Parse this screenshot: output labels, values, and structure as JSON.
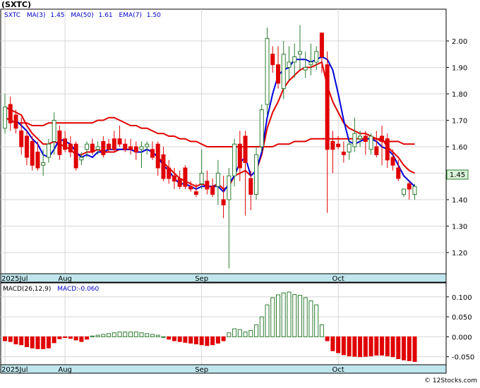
{
  "title": "(SXTC)",
  "watermark": "© 12Stocks.com",
  "price_legend": {
    "symbol": "SXTC",
    "ma3_label": "MA(3)",
    "ma3_value": "1.45",
    "ma50_label": "MA(50)",
    "ma50_value": "1.61",
    "ema7_label": "EMA(7)",
    "ema7_value": "1.50"
  },
  "macd_legend": {
    "params": "MACD(26,12,9)",
    "value_label": "MACD:-0.060"
  },
  "last_price": "1.45",
  "x_labels": [
    {
      "text": "2025Jul",
      "idx": 0
    },
    {
      "text": "Aug",
      "idx": 11
    },
    {
      "text": "Sep",
      "idx": 36
    },
    {
      "text": "Oct",
      "idx": 61
    }
  ],
  "colors": {
    "up": "#2e7d32",
    "down": "#e00000",
    "ma_short": "#0000dd",
    "ema": "#e00000",
    "axis_bar": "#bfe6ec",
    "grid": "#d6d6d6",
    "frame": "#000000"
  },
  "chart_data": [
    {
      "type": "candlestick",
      "ylim": [
        1.12,
        2.12
      ],
      "yticks": [
        1.2,
        1.3,
        1.4,
        1.5,
        1.6,
        1.7,
        1.8,
        1.9,
        2.0
      ],
      "grid": true,
      "ohlc": [
        [
          1.67,
          1.8,
          1.65,
          1.75
        ],
        [
          1.76,
          1.79,
          1.66,
          1.69
        ],
        [
          1.72,
          1.74,
          1.65,
          1.67
        ],
        [
          1.66,
          1.71,
          1.57,
          1.6
        ],
        [
          1.64,
          1.66,
          1.53,
          1.56
        ],
        [
          1.62,
          1.64,
          1.51,
          1.53
        ],
        [
          1.58,
          1.62,
          1.51,
          1.52
        ],
        [
          1.53,
          1.59,
          1.49,
          1.54
        ],
        [
          1.56,
          1.63,
          1.54,
          1.61
        ],
        [
          1.62,
          1.73,
          1.57,
          1.7
        ],
        [
          1.66,
          1.68,
          1.55,
          1.57
        ],
        [
          1.63,
          1.66,
          1.58,
          1.59
        ],
        [
          1.61,
          1.64,
          1.56,
          1.58
        ],
        [
          1.61,
          1.62,
          1.51,
          1.52
        ],
        [
          1.55,
          1.58,
          1.53,
          1.56
        ],
        [
          1.59,
          1.62,
          1.56,
          1.61
        ],
        [
          1.61,
          1.63,
          1.57,
          1.58
        ],
        [
          1.59,
          1.62,
          1.57,
          1.6
        ],
        [
          1.62,
          1.64,
          1.56,
          1.57
        ],
        [
          1.61,
          1.63,
          1.58,
          1.59
        ],
        [
          1.63,
          1.66,
          1.58,
          1.59
        ],
        [
          1.63,
          1.68,
          1.6,
          1.61
        ],
        [
          1.61,
          1.63,
          1.58,
          1.59
        ],
        [
          1.6,
          1.63,
          1.57,
          1.59
        ],
        [
          1.6,
          1.62,
          1.55,
          1.58
        ],
        [
          1.59,
          1.62,
          1.52,
          1.6
        ],
        [
          1.6,
          1.62,
          1.57,
          1.61
        ],
        [
          1.59,
          1.62,
          1.55,
          1.56
        ],
        [
          1.61,
          1.62,
          1.49,
          1.52
        ],
        [
          1.57,
          1.6,
          1.47,
          1.48
        ],
        [
          1.52,
          1.55,
          1.46,
          1.48
        ],
        [
          1.49,
          1.52,
          1.44,
          1.47
        ],
        [
          1.48,
          1.51,
          1.44,
          1.45
        ],
        [
          1.52,
          1.53,
          1.44,
          1.45
        ],
        [
          1.45,
          1.47,
          1.43,
          1.44
        ],
        [
          1.43,
          1.46,
          1.41,
          1.42
        ],
        [
          1.46,
          1.59,
          1.44,
          1.5
        ],
        [
          1.47,
          1.51,
          1.42,
          1.44
        ],
        [
          1.45,
          1.48,
          1.41,
          1.42
        ],
        [
          1.45,
          1.55,
          1.38,
          1.5
        ],
        [
          1.4,
          1.49,
          1.33,
          1.38
        ],
        [
          1.4,
          1.52,
          1.14,
          1.49
        ],
        [
          1.49,
          1.63,
          1.45,
          1.61
        ],
        [
          1.61,
          1.66,
          1.47,
          1.52
        ],
        [
          1.64,
          1.66,
          1.34,
          1.54
        ],
        [
          1.48,
          1.51,
          1.36,
          1.42
        ],
        [
          1.42,
          1.6,
          1.4,
          1.57
        ],
        [
          1.6,
          1.76,
          1.58,
          1.74
        ],
        [
          1.76,
          2.05,
          1.72,
          2.01
        ],
        [
          1.95,
          1.98,
          1.88,
          1.91
        ],
        [
          1.91,
          1.98,
          1.82,
          1.84
        ],
        [
          1.82,
          2.0,
          1.78,
          1.95
        ],
        [
          1.9,
          1.98,
          1.85,
          1.92
        ],
        [
          1.92,
          1.99,
          1.86,
          1.94
        ],
        [
          1.95,
          2.06,
          1.89,
          1.96
        ],
        [
          1.89,
          1.96,
          1.86,
          1.9
        ],
        [
          1.91,
          1.99,
          1.87,
          1.92
        ],
        [
          1.92,
          1.98,
          1.89,
          1.96
        ],
        [
          2.03,
          2.03,
          1.88,
          1.94
        ],
        [
          1.91,
          1.96,
          1.35,
          1.59
        ],
        [
          1.62,
          1.66,
          1.5,
          1.59
        ],
        [
          1.61,
          1.64,
          1.59,
          1.6
        ],
        [
          1.58,
          1.62,
          1.54,
          1.57
        ],
        [
          1.58,
          1.63,
          1.55,
          1.61
        ],
        [
          1.6,
          1.71,
          1.58,
          1.65
        ],
        [
          1.63,
          1.66,
          1.6,
          1.64
        ],
        [
          1.64,
          1.66,
          1.57,
          1.62
        ],
        [
          1.59,
          1.65,
          1.57,
          1.64
        ],
        [
          1.6,
          1.66,
          1.56,
          1.57
        ],
        [
          1.64,
          1.68,
          1.53,
          1.62
        ],
        [
          1.63,
          1.65,
          1.52,
          1.55
        ],
        [
          1.56,
          1.59,
          1.51,
          1.53
        ],
        [
          1.52,
          1.55,
          1.47,
          1.48
        ],
        [
          1.42,
          1.44,
          1.41,
          1.44
        ],
        [
          1.46,
          1.47,
          1.4,
          1.44
        ],
        [
          1.42,
          1.46,
          1.4,
          1.45
        ]
      ],
      "ma50": [
        1.71,
        1.7,
        1.69,
        1.69,
        1.69,
        1.68,
        1.68,
        1.68,
        1.69,
        1.69,
        1.69,
        1.69,
        1.69,
        1.69,
        1.69,
        1.69,
        1.69,
        1.7,
        1.7,
        1.71,
        1.71,
        1.7,
        1.69,
        1.68,
        1.68,
        1.67,
        1.67,
        1.66,
        1.65,
        1.65,
        1.64,
        1.64,
        1.63,
        1.63,
        1.62,
        1.62,
        1.61,
        1.6,
        1.6,
        1.6,
        1.6,
        1.6,
        1.6,
        1.6,
        1.6,
        1.6,
        1.6,
        1.6,
        1.6,
        1.6,
        1.61,
        1.61,
        1.61,
        1.62,
        1.62,
        1.62,
        1.63,
        1.63,
        1.63,
        1.63,
        1.63,
        1.63,
        1.63,
        1.63,
        1.63,
        1.63,
        1.63,
        1.63,
        1.63,
        1.62,
        1.62,
        1.62,
        1.62,
        1.61,
        1.61,
        1.61
      ],
      "ma_short": [
        null,
        null,
        1.7,
        1.68,
        1.66,
        1.63,
        1.61,
        1.57,
        1.56,
        1.59,
        1.63,
        1.62,
        1.61,
        1.58,
        1.56,
        1.57,
        1.56,
        1.58,
        1.58,
        1.59,
        1.59,
        1.59,
        1.59,
        1.59,
        1.58,
        1.58,
        1.59,
        1.58,
        1.56,
        1.53,
        1.51,
        1.48,
        1.46,
        1.46,
        1.45,
        1.44,
        1.45,
        1.45,
        1.45,
        1.45,
        1.43,
        1.46,
        1.49,
        1.54,
        1.56,
        1.49,
        1.51,
        1.58,
        1.71,
        1.8,
        1.87,
        1.89,
        1.9,
        1.93,
        1.93,
        1.93,
        1.92,
        1.93,
        1.94,
        1.93,
        1.89,
        1.8,
        1.7,
        1.62,
        1.61,
        1.62,
        1.63,
        1.63,
        1.62,
        1.6,
        1.59,
        1.57,
        1.53,
        1.49,
        1.47,
        1.45
      ],
      "ema7": [
        1.75,
        1.74,
        1.73,
        1.72,
        1.68,
        1.65,
        1.63,
        1.61,
        1.61,
        1.62,
        1.61,
        1.6,
        1.59,
        1.57,
        1.57,
        1.58,
        1.58,
        1.59,
        1.58,
        1.58,
        1.58,
        1.59,
        1.59,
        1.59,
        1.58,
        1.58,
        1.59,
        1.58,
        1.56,
        1.54,
        1.52,
        1.5,
        1.48,
        1.47,
        1.46,
        1.45,
        1.46,
        1.45,
        1.45,
        1.46,
        1.44,
        1.45,
        1.49,
        1.5,
        1.51,
        1.49,
        1.51,
        1.57,
        1.67,
        1.73,
        1.77,
        1.82,
        1.85,
        1.87,
        1.89,
        1.9,
        1.9,
        1.91,
        1.92,
        1.83,
        1.77,
        1.73,
        1.69,
        1.67,
        1.66,
        1.65,
        1.65,
        1.64,
        1.63,
        1.63,
        1.6,
        1.58,
        1.56,
        1.53,
        1.51,
        1.5
      ]
    },
    {
      "type": "bar",
      "title": "MACD(26,12,9)",
      "ylim": [
        -0.07,
        0.135
      ],
      "yticks": [
        -0.05,
        0.0,
        0.05,
        0.1
      ],
      "ytick_labels": [
        "-0.050",
        "0.000",
        "0.050",
        "0.100"
      ],
      "grid": true,
      "values": [
        -0.01,
        -0.012,
        -0.018,
        -0.02,
        -0.025,
        -0.028,
        -0.03,
        -0.03,
        -0.028,
        -0.015,
        -0.005,
        -0.002,
        -0.004,
        -0.008,
        -0.012,
        -0.006,
        0.002,
        0.004,
        0.006,
        0.008,
        0.01,
        0.012,
        0.012,
        0.012,
        0.012,
        0.01,
        0.008,
        0.006,
        0.004,
        0.0,
        -0.006,
        -0.01,
        -0.012,
        -0.014,
        -0.016,
        -0.018,
        -0.02,
        -0.022,
        -0.02,
        -0.016,
        -0.01,
        0.01,
        0.02,
        0.018,
        0.012,
        0.016,
        0.03,
        0.05,
        0.08,
        0.098,
        0.105,
        0.11,
        0.112,
        0.106,
        0.104,
        0.098,
        0.09,
        0.08,
        0.03,
        -0.01,
        -0.035,
        -0.04,
        -0.045,
        -0.048,
        -0.049,
        -0.05,
        -0.049,
        -0.048,
        -0.046,
        -0.046,
        -0.048,
        -0.05,
        -0.055,
        -0.058,
        -0.06,
        -0.062
      ]
    }
  ]
}
